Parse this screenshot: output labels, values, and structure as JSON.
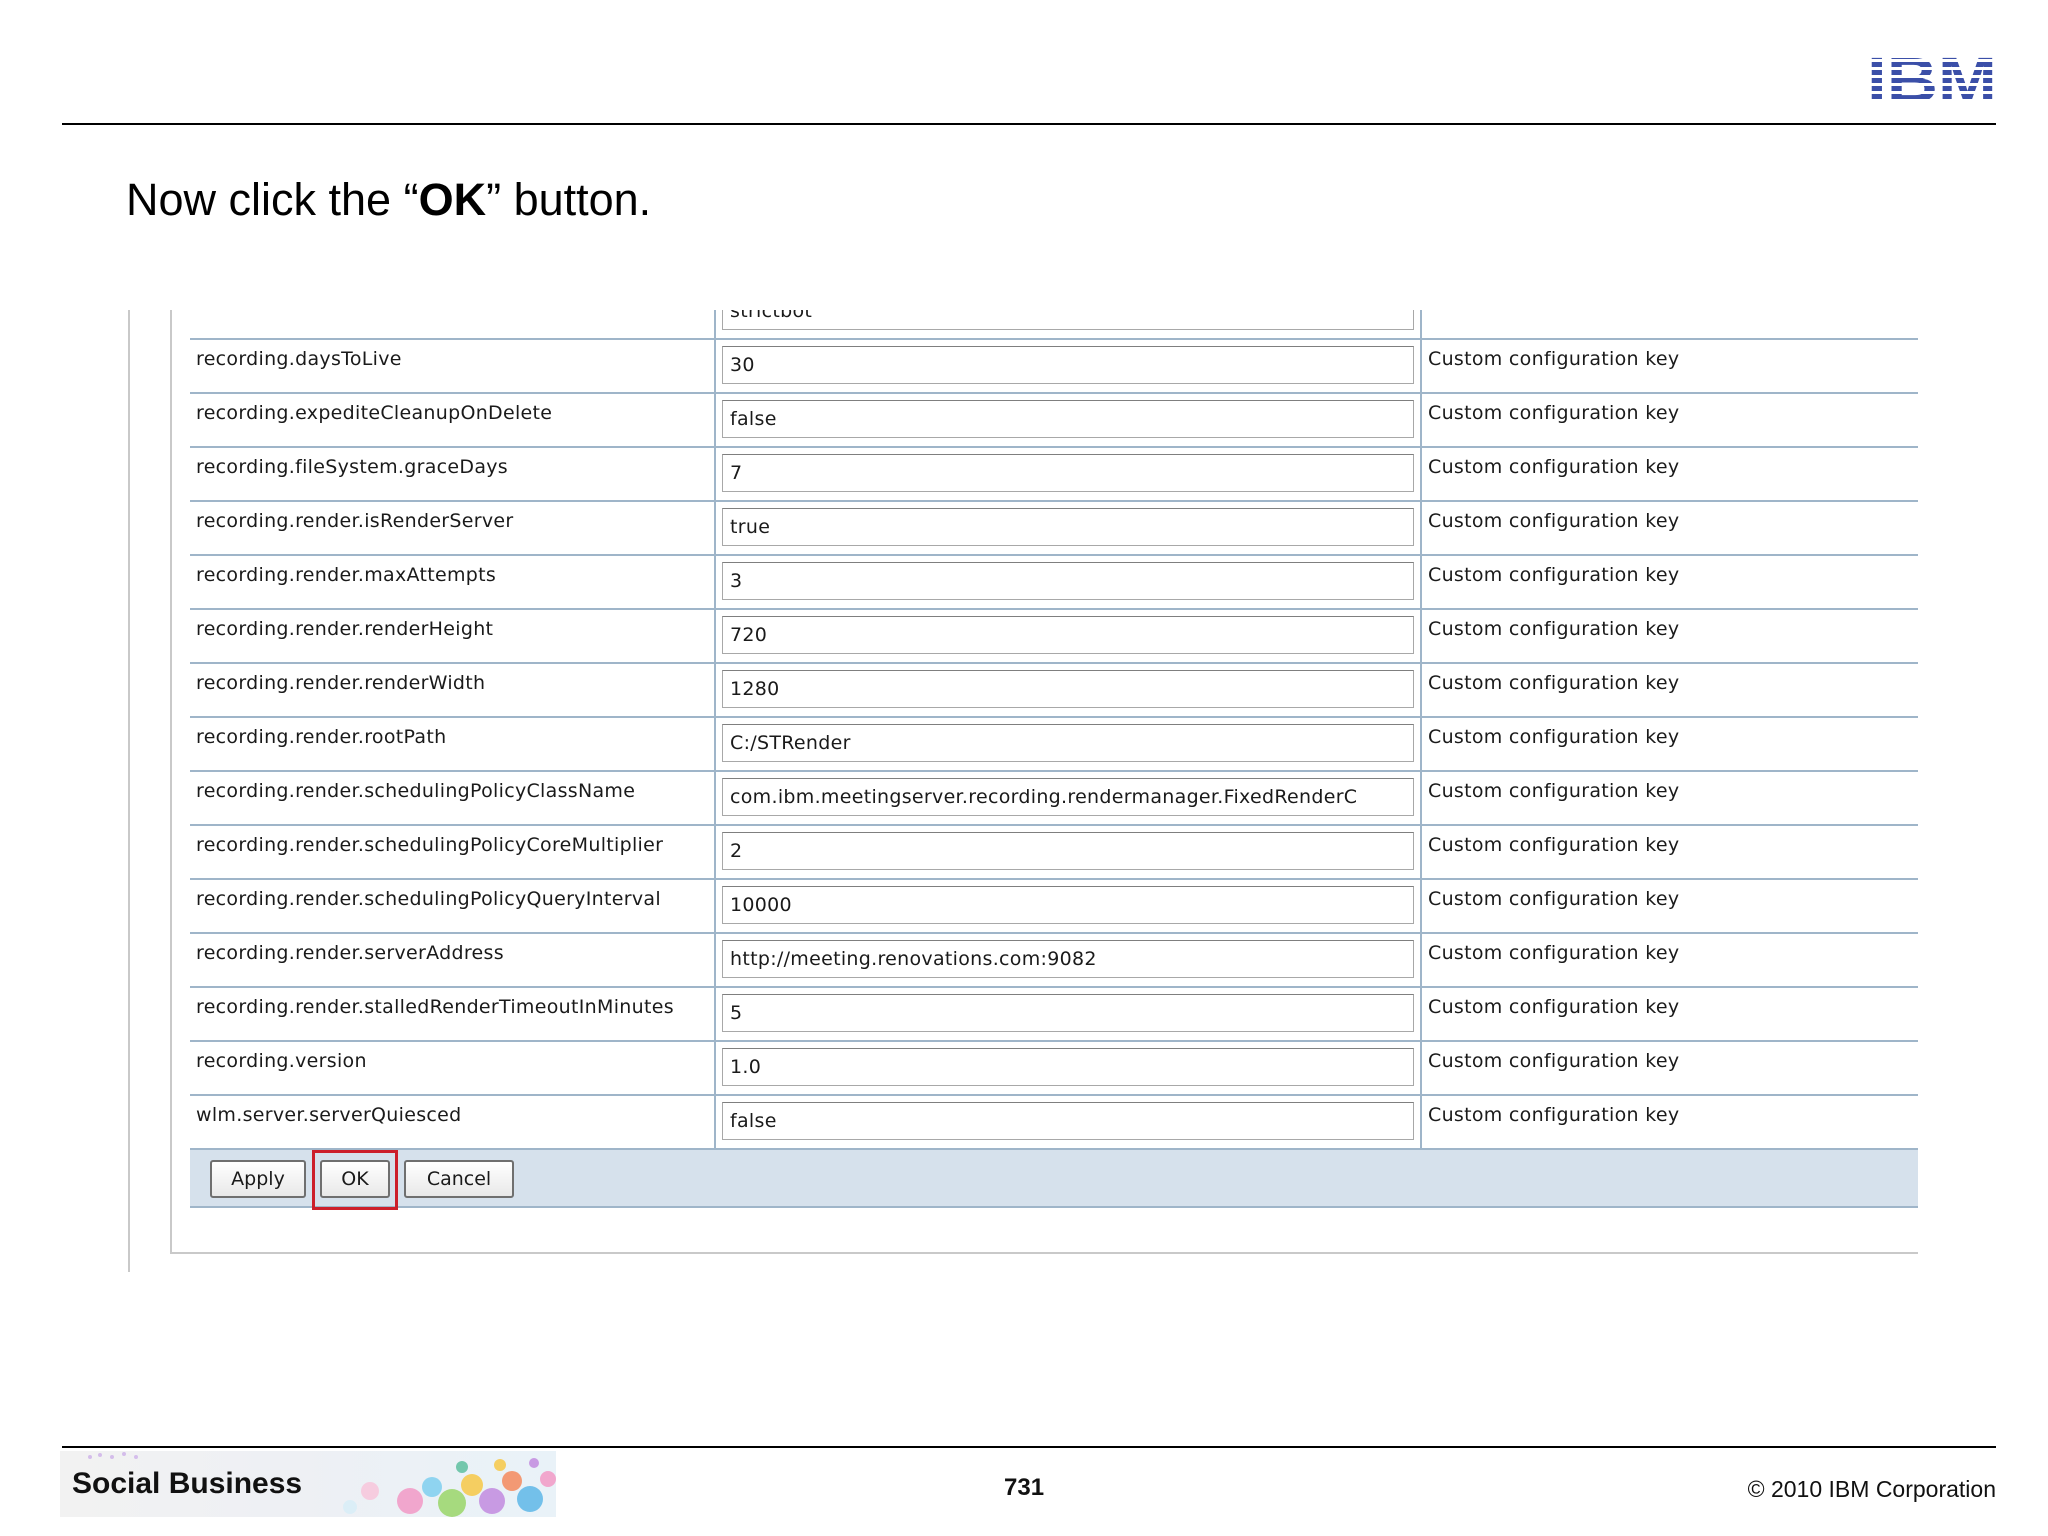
{
  "slide": {
    "title_prefix": "Now click the “",
    "title_bold": "OK",
    "title_suffix": "” button.",
    "brand_logo": "IBM",
    "footer_banner": "Social Business",
    "page_number": "731",
    "copyright": "© 2010 IBM Corporation"
  },
  "table": {
    "partial_top_value": "strictbot",
    "rows": [
      {
        "name": "recording.daysToLive",
        "value": "30",
        "description": "Custom configuration key"
      },
      {
        "name": "recording.expediteCleanupOnDelete",
        "value": "false",
        "description": "Custom configuration key"
      },
      {
        "name": "recording.fileSystem.graceDays",
        "value": "7",
        "description": "Custom configuration key"
      },
      {
        "name": "recording.render.isRenderServer",
        "value": "true",
        "description": "Custom configuration key"
      },
      {
        "name": "recording.render.maxAttempts",
        "value": "3",
        "description": "Custom configuration key"
      },
      {
        "name": "recording.render.renderHeight",
        "value": "720",
        "description": "Custom configuration key"
      },
      {
        "name": "recording.render.renderWidth",
        "value": "1280",
        "description": "Custom configuration key"
      },
      {
        "name": "recording.render.rootPath",
        "value": "C:/STRender",
        "description": "Custom configuration key"
      },
      {
        "name": "recording.render.schedulingPolicyClassName",
        "value": "com.ibm.meetingserver.recording.rendermanager.FixedRenderC",
        "description": "Custom configuration key"
      },
      {
        "name": "recording.render.schedulingPolicyCoreMultiplier",
        "value": "2",
        "description": "Custom configuration key"
      },
      {
        "name": "recording.render.schedulingPolicyQueryInterval",
        "value": "10000",
        "description": "Custom configuration key"
      },
      {
        "name": "recording.render.serverAddress",
        "value": "http://meeting.renovations.com:9082",
        "description": "Custom configuration key"
      },
      {
        "name": "recording.render.stalledRenderTimeoutInMinutes",
        "value": "5",
        "description": "Custom configuration key"
      },
      {
        "name": "recording.version",
        "value": "1.0",
        "description": "Custom configuration key"
      },
      {
        "name": "wlm.server.serverQuiesced",
        "value": "false",
        "description": "Custom configuration key"
      }
    ]
  },
  "buttons": {
    "apply": "Apply",
    "ok": "OK",
    "cancel": "Cancel"
  },
  "colors": {
    "highlight": "#cc1f2b",
    "grid_line": "#9fb5c9",
    "button_bar": "#d6e1ec",
    "ibm_blue": "#3b4fa8"
  }
}
